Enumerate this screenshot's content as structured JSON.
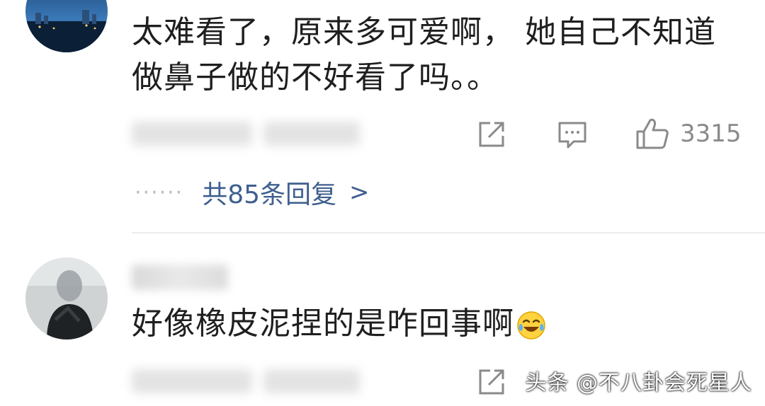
{
  "comments": [
    {
      "text": "太难看了，原来多可爱啊， 她自己不知道做鼻子做的不好看了吗。。",
      "likes": "3315",
      "replies_label": "共85条回复",
      "replies_dots": "······",
      "replies_chevron": ">",
      "avatar_icon": "city-night-avatar"
    },
    {
      "text": "好像橡皮泥捏的是咋回事啊",
      "emoji": "laughing-crying-emoji",
      "avatar_icon": "person-photo-avatar"
    }
  ],
  "icons": {
    "share": "share-icon",
    "comment": "comment-icon",
    "like": "thumbs-up-icon"
  },
  "watermark": "头条 @不八卦会死星人",
  "colors": {
    "reply_link": "#3f5f8f",
    "muted": "#8a8a8a",
    "divider": "#ececec"
  }
}
